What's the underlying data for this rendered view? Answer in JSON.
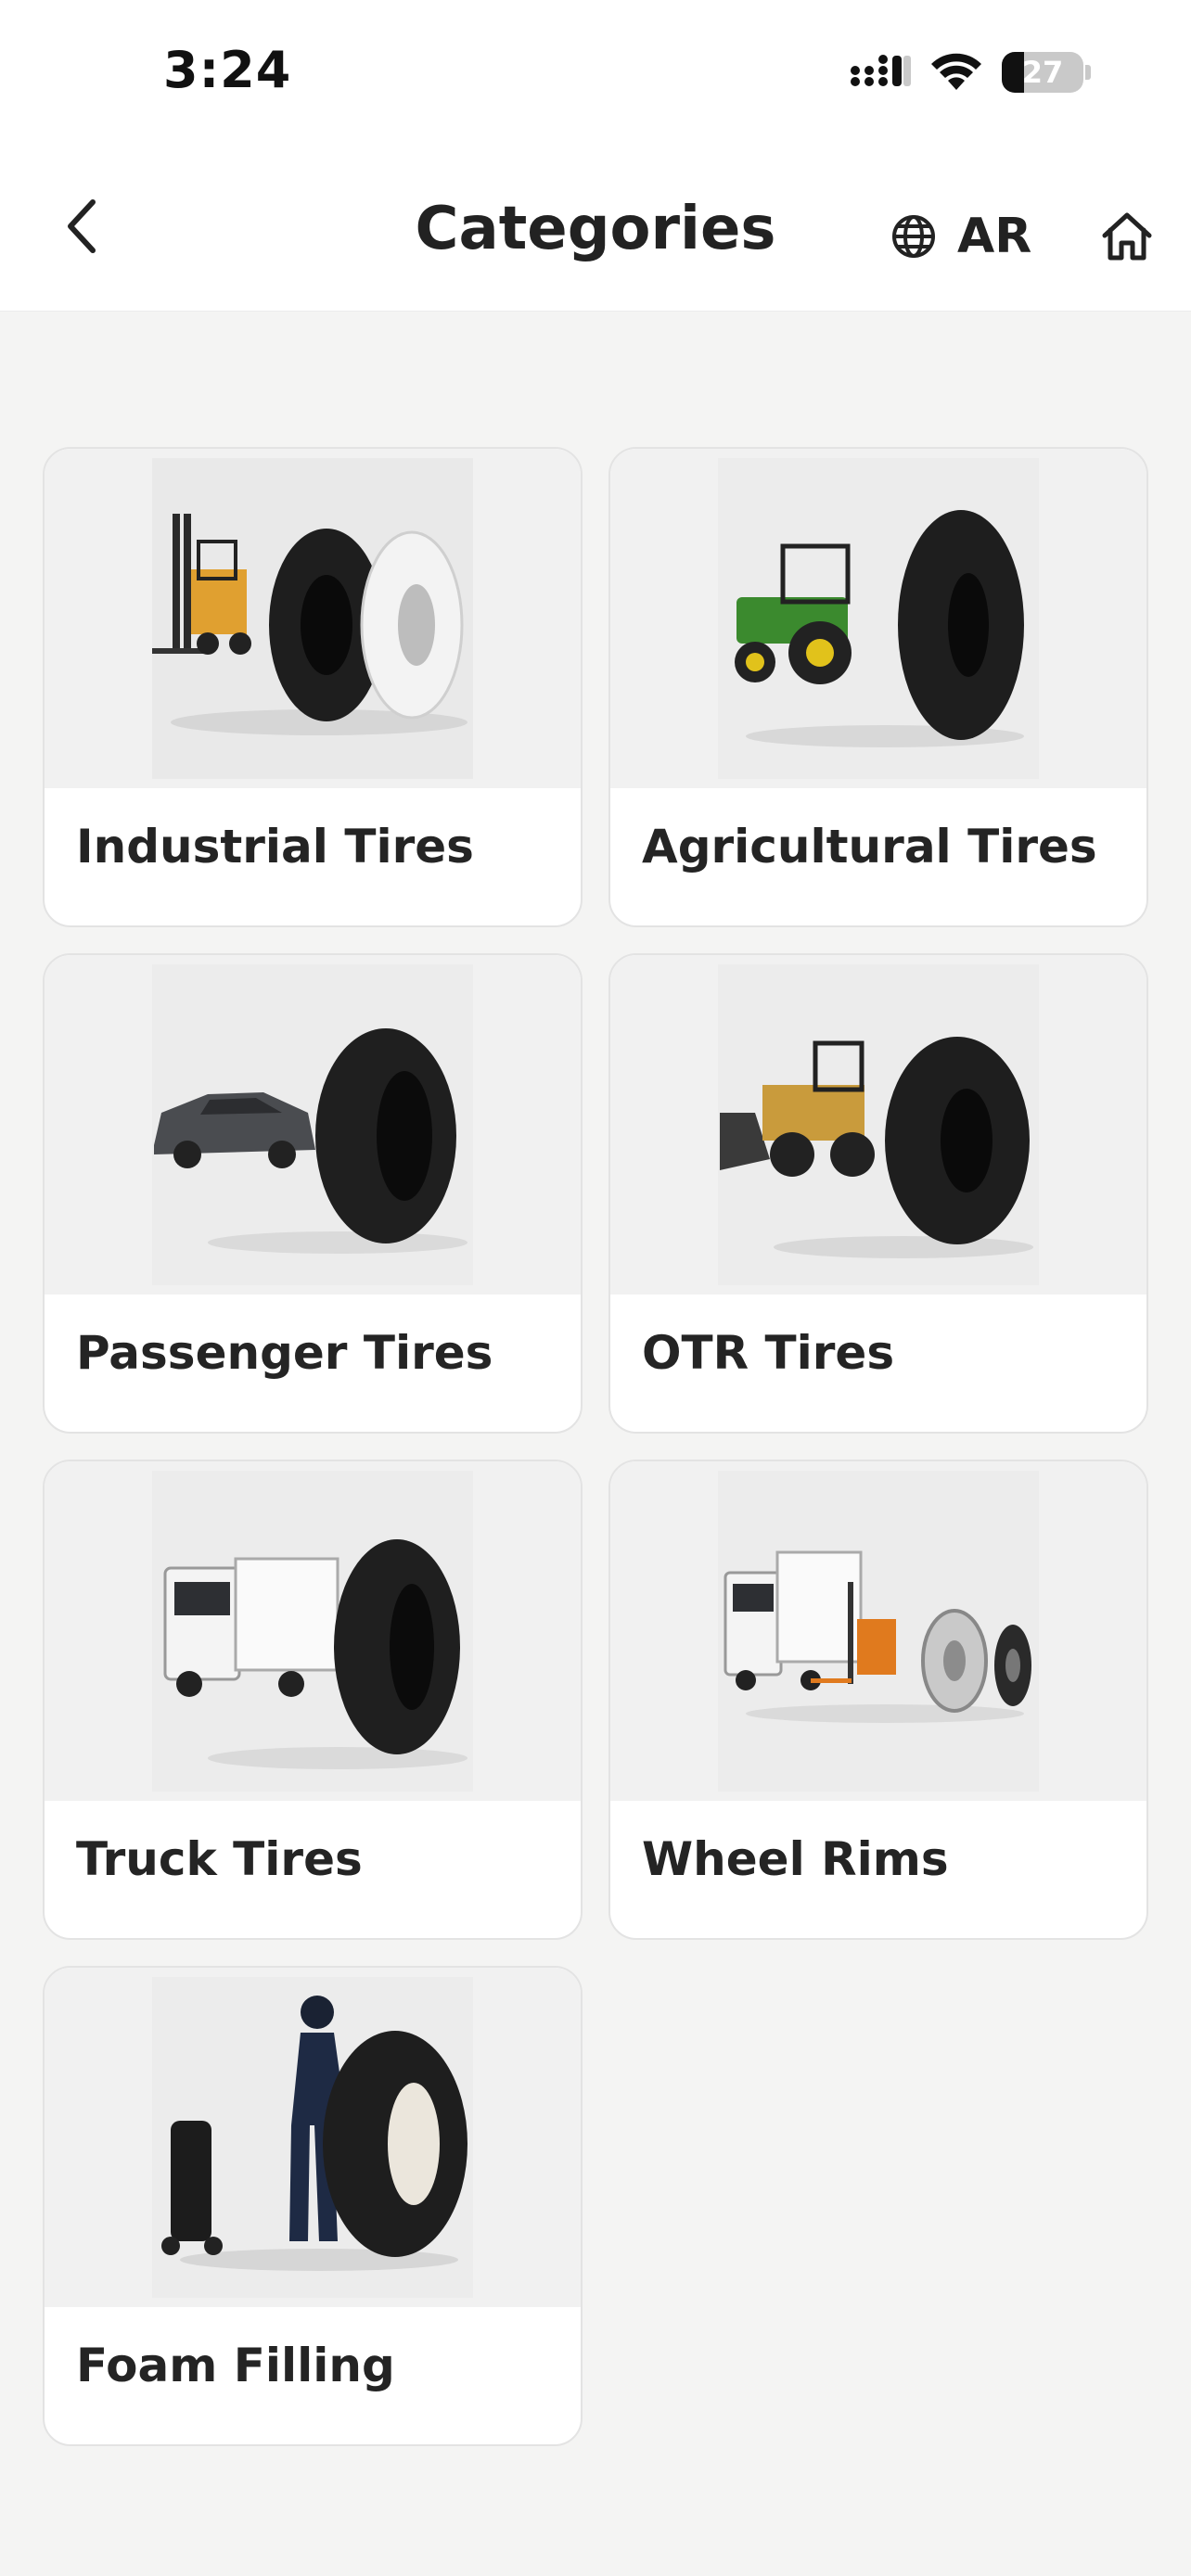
{
  "status_bar": {
    "time": "3:24",
    "battery": "27"
  },
  "header": {
    "title": "Categories",
    "language": "AR"
  },
  "categories": [
    {
      "label": "Industrial Tires",
      "image": "forklift-and-industrial-tires"
    },
    {
      "label": "Agricultural Tires",
      "image": "tractor-and-agricultural-tire"
    },
    {
      "label": "Passenger Tires",
      "image": "car-and-passenger-tire"
    },
    {
      "label": "OTR Tires",
      "image": "wheel-loader-and-otr-tire"
    },
    {
      "label": "Truck Tires",
      "image": "truck-and-truck-tire"
    },
    {
      "label": "Wheel Rims",
      "image": "truck-forklift-and-wheel-rims"
    },
    {
      "label": "Foam Filling",
      "image": "worker-foam-filling-tire"
    }
  ],
  "colors": {
    "background": "#f4f4f3",
    "card": "#ffffff",
    "text": "#242424"
  }
}
